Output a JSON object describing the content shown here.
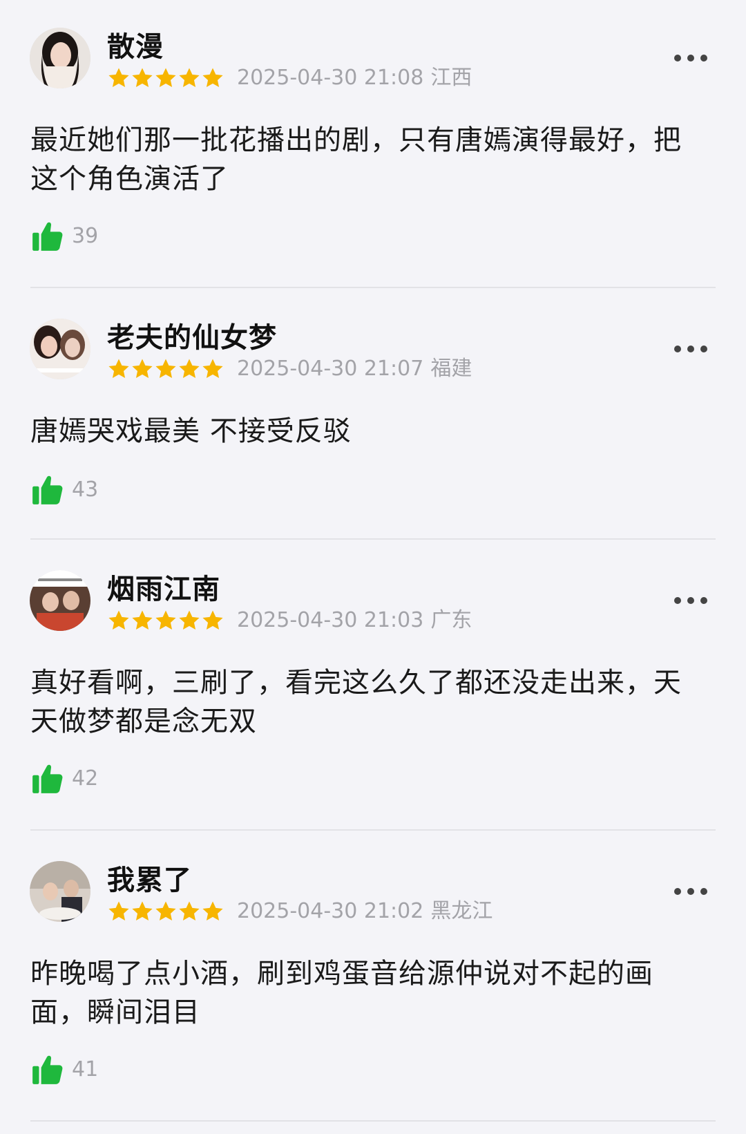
{
  "colors": {
    "star": "#f7b500",
    "like_icon": "#1fb83d",
    "meta_text": "#a3a3a8",
    "background": "#f4f4f8"
  },
  "icons": {
    "star": "star-icon",
    "like": "thumbs-up-icon",
    "more": "more-horizontal-icon"
  },
  "reviews": [
    {
      "username": "散漫",
      "rating": 5,
      "timestamp": "2025-04-30 21:08",
      "location": "江西",
      "comment": "最近她们那一批花播出的剧，只有唐嫣演得最好，把这个角色演活了",
      "likes": "39"
    },
    {
      "username": "老夫的仙女梦",
      "rating": 5,
      "timestamp": "2025-04-30 21:07",
      "location": "福建",
      "comment": "唐嫣哭戏最美 不接受反驳",
      "likes": "43"
    },
    {
      "username": "烟雨江南",
      "rating": 5,
      "timestamp": "2025-04-30 21:03",
      "location": "广东",
      "comment": "真好看啊，三刷了，看完这么久了都还没走出来，天天做梦都是念无双",
      "likes": "42"
    },
    {
      "username": "我累了",
      "rating": 5,
      "timestamp": "2025-04-30 21:02",
      "location": "黑龙江",
      "comment": "昨晚喝了点小酒，刷到鸡蛋音给源仲说对不起的画面，瞬间泪目",
      "likes": "41"
    }
  ]
}
